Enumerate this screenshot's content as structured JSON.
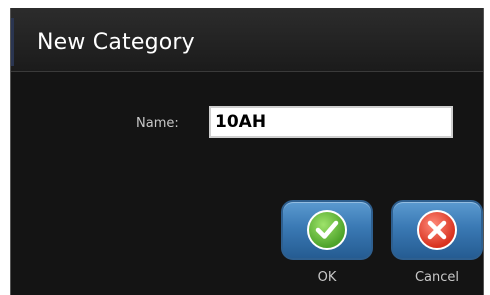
{
  "dialog": {
    "title": "New Category",
    "name_label": "Name:",
    "name_value": "10AH"
  },
  "buttons": {
    "ok_label": "OK",
    "cancel_label": "Cancel"
  },
  "icons": {
    "ok": "checkmark-icon",
    "cancel": "close-icon"
  },
  "colors": {
    "button_blue": "#3a79b4",
    "ok_green": "#4ea32a",
    "cancel_red": "#d8321f",
    "background": "#141414"
  }
}
